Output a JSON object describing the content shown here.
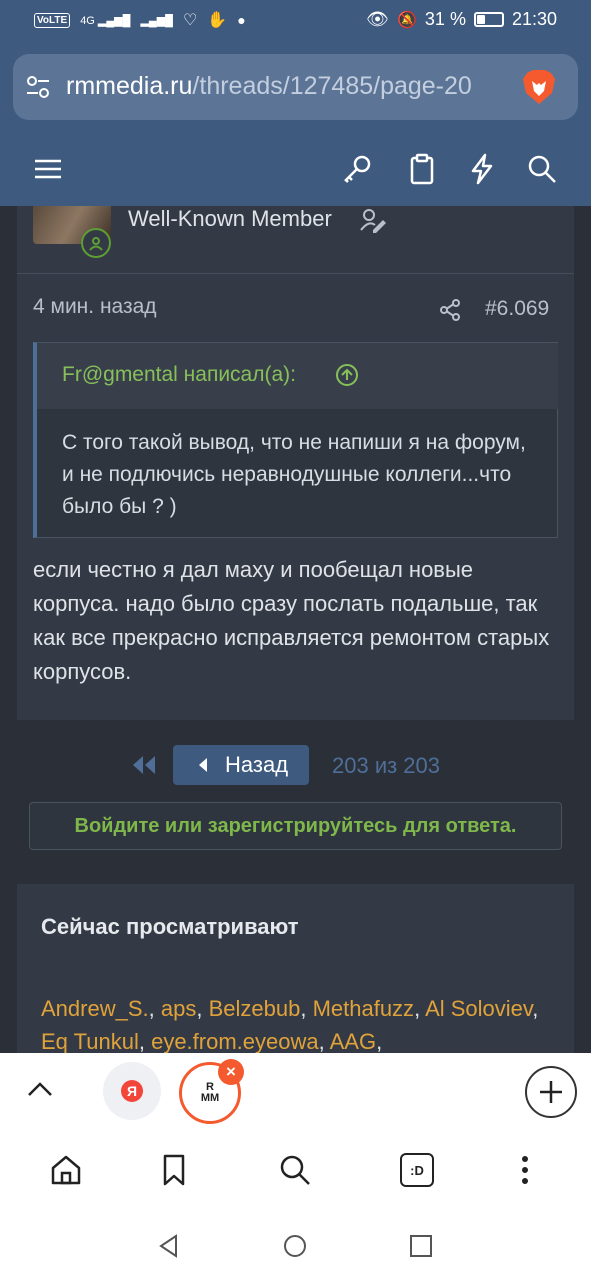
{
  "status_bar": {
    "network_chip": "VoLTE",
    "signal_label": "4G",
    "battery_percent": "31 %",
    "time": "21:30"
  },
  "browser": {
    "url_host": "rmmedia.ru",
    "url_path": "/threads/127485/page-20"
  },
  "post": {
    "member_title": "Well-Known Member",
    "time_ago": "4 мин. назад",
    "post_number": "#6.069",
    "quote_author": "Fr@gmental написал(а):",
    "quote_text": "С того такой вывод, что не напиши я на форум, и не подлючись неравнодушные коллеги...что было бы ? )",
    "body_text": "если честно я дал маху и пообещал новые корпуса. надо было сразу послать подальше, так как все прекрасно исправляется ремонтом старых корпусов."
  },
  "pager": {
    "back_label": "Назад",
    "status": "203 из 203"
  },
  "login_prompt": "Войдите или зарегистрируйтесь для ответа.",
  "viewers": {
    "title": "Сейчас просматривают",
    "names": [
      "Andrew_S.",
      "aps",
      "Belzebub",
      "Methafuzz",
      "Al Soloviev",
      "Eq Tunkul",
      "eye.from.eyeowa",
      "AAG"
    ]
  },
  "tabs": {
    "tab1_letter": "Я",
    "tab2_letters": [
      "R",
      "MM"
    ],
    "close_glyph": "×"
  },
  "bottom_nav": {
    "tabs_label": ":D"
  },
  "colors": {
    "header_bg": "#3f5a7f",
    "page_bg": "#2a2f38",
    "card_bg": "#343a45",
    "link_green": "#87c05a",
    "name_orange": "#e0a23a",
    "accent_blue": "#4f6f98",
    "brave_orange": "#f45a2e"
  }
}
